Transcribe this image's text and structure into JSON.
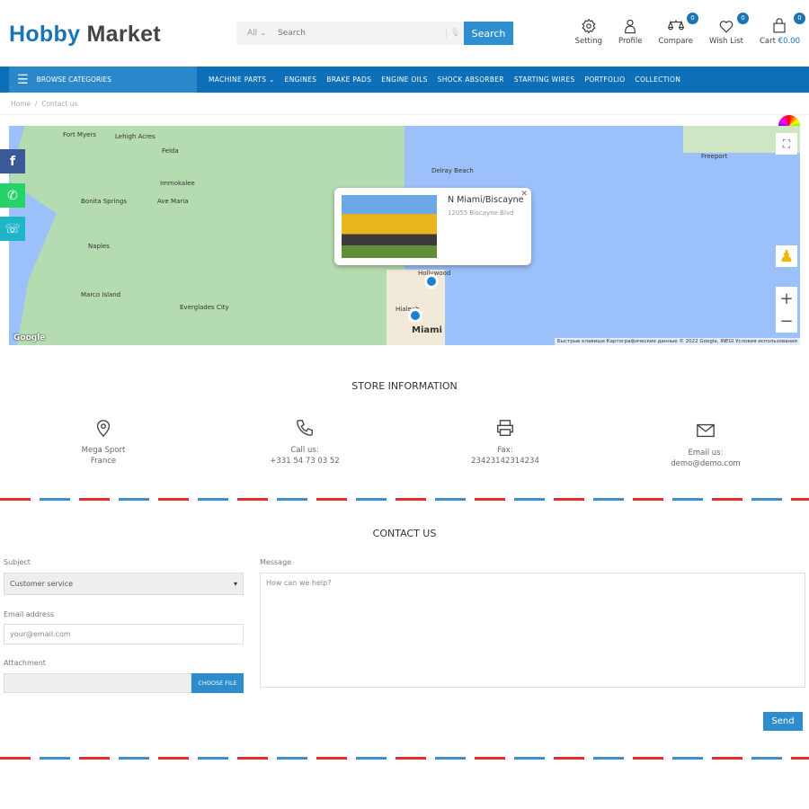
{
  "header": {
    "logo_part1": "Hobby",
    "logo_part2": "Market",
    "search_category": "All",
    "search_placeholder": "Search",
    "search_button": "Search",
    "tools": [
      {
        "label": "Setting",
        "icon": "gear-icon"
      },
      {
        "label": "Profile",
        "icon": "user-icon"
      },
      {
        "label": "Compare",
        "icon": "scale-icon",
        "badge": "0"
      },
      {
        "label": "Wish List",
        "icon": "heart-icon",
        "badge": "0"
      },
      {
        "label": "Cart",
        "icon": "bag-icon",
        "badge": "0",
        "amount": "€0.00"
      }
    ]
  },
  "nav": {
    "browse": "BROWSE CATEGORIES",
    "items": [
      "MACHINE PARTS",
      "ENGINES",
      "BRAKE PADS",
      "ENGINE OILS",
      "SHOCK ABSORBER",
      "STARTING WIRES",
      "PORTFOLIO",
      "COLLECTION"
    ]
  },
  "breadcrumb": [
    "Home",
    "Contact us"
  ],
  "map": {
    "popup_title": "N Miami/Biscayne",
    "popup_address": "12055 Biscayne Blvd",
    "attribution": "Быстрые клавиши   Картографические данные © 2022 Google, INEGI   Условия использования",
    "google": "Google",
    "labels": [
      "Fort Myers",
      "Lehigh Acres",
      "Felda",
      "Immokalee",
      "Ave Maria",
      "Bonita Springs",
      "Naples",
      "Marco Island",
      "Everglades City",
      "Delray Beach",
      "Hollywood",
      "Hialeah",
      "Miami",
      "Freeport"
    ]
  },
  "store": {
    "title": "STORE INFORMATION",
    "items": [
      {
        "icon": "location-icon",
        "line1": "Mega Sport",
        "line2": "France"
      },
      {
        "icon": "phone-icon",
        "line1": "Call us:",
        "line2": "+331 54 73 03 52"
      },
      {
        "icon": "printer-icon",
        "line1": "Fax:",
        "line2": "23423142314234"
      },
      {
        "icon": "mail-icon",
        "line1": "Email us:",
        "line2": "demo@demo.com"
      }
    ]
  },
  "contact": {
    "title": "CONTACT US",
    "subject_label": "Subject",
    "subject_value": "Customer service",
    "email_label": "Email address",
    "email_placeholder": "your@email.com",
    "attachment_label": "Attachment",
    "choose_file": "CHOOSE FILE",
    "message_label": "Message",
    "message_placeholder": "How can we help?",
    "send": "Send"
  },
  "colors": {
    "brand": "#1a74b3",
    "nav": "#0c6fb8",
    "facebook": "#3b5998",
    "whatsapp": "#25d366",
    "phone": "#1fb5c9"
  }
}
